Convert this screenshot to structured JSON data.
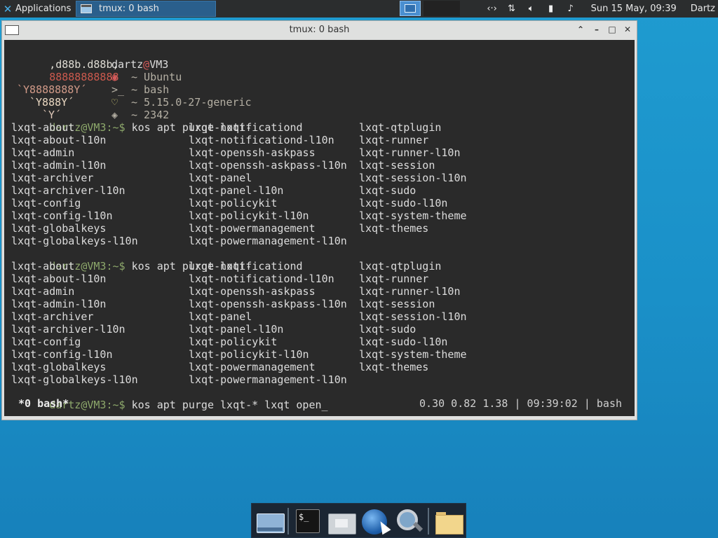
{
  "top_panel": {
    "apps_label": "Applications",
    "task_label": "tmux: 0 bash",
    "clock": "Sun 15 May, 09:39",
    "user": "Dartz",
    "tray_icons": [
      "network-transfer-icon",
      "updown-arrows-icon",
      "volume-icon",
      "battery-icon",
      "notification-bell-icon"
    ]
  },
  "window": {
    "title": "tmux: 0 bash"
  },
  "terminal": {
    "neofetch": {
      "logo": [
        ",d88b.d88b,",
        "88888888888",
        "`Y8888888Y´",
        "`Y888Y´",
        "`Y´"
      ],
      "user": "dartz",
      "at": "@",
      "host": "VM3",
      "os": "~ Ubuntu",
      "shell": "~ bash",
      "kernel": "~ 5.15.0-27-generic",
      "packages": "~ 2342",
      "os_icon": "ubuntu-icon",
      "shell_icon": "terminal-prompt-icon",
      "kernel_icon": "heart-icon",
      "packages_icon": "package-icon"
    },
    "prompt_user": "dartz@VM3",
    "prompt_dir": ":~$",
    "command1": " kos apt purge lxqt-",
    "command2": " kos apt purge lxqt-",
    "command3": " kos apt purge lxqt-* lxqt open_",
    "completions": [
      [
        "lxqt-about",
        "lxqt-notificationd",
        "lxqt-qtplugin"
      ],
      [
        "lxqt-about-l10n",
        "lxqt-notificationd-l10n",
        "lxqt-runner"
      ],
      [
        "lxqt-admin",
        "lxqt-openssh-askpass",
        "lxqt-runner-l10n"
      ],
      [
        "lxqt-admin-l10n",
        "lxqt-openssh-askpass-l10n",
        "lxqt-session"
      ],
      [
        "lxqt-archiver",
        "lxqt-panel",
        "lxqt-session-l10n"
      ],
      [
        "lxqt-archiver-l10n",
        "lxqt-panel-l10n",
        "lxqt-sudo"
      ],
      [
        "lxqt-config",
        "lxqt-policykit",
        "lxqt-sudo-l10n"
      ],
      [
        "lxqt-config-l10n",
        "lxqt-policykit-l10n",
        "lxqt-system-theme"
      ],
      [
        "lxqt-globalkeys",
        "lxqt-powermanagement",
        "lxqt-themes"
      ],
      [
        "lxqt-globalkeys-l10n",
        "lxqt-powermanagement-l10n",
        ""
      ]
    ],
    "status_left": "*0 bash*",
    "status_right": "0.30 0.82 1.38 | 09:39:02 | bash"
  },
  "dock": {
    "items": [
      "show-desktop-icon",
      "terminal-icon",
      "home-folder-icon",
      "web-browser-icon",
      "search-icon",
      "file-manager-icon"
    ],
    "terminal_glyph": "$_"
  }
}
